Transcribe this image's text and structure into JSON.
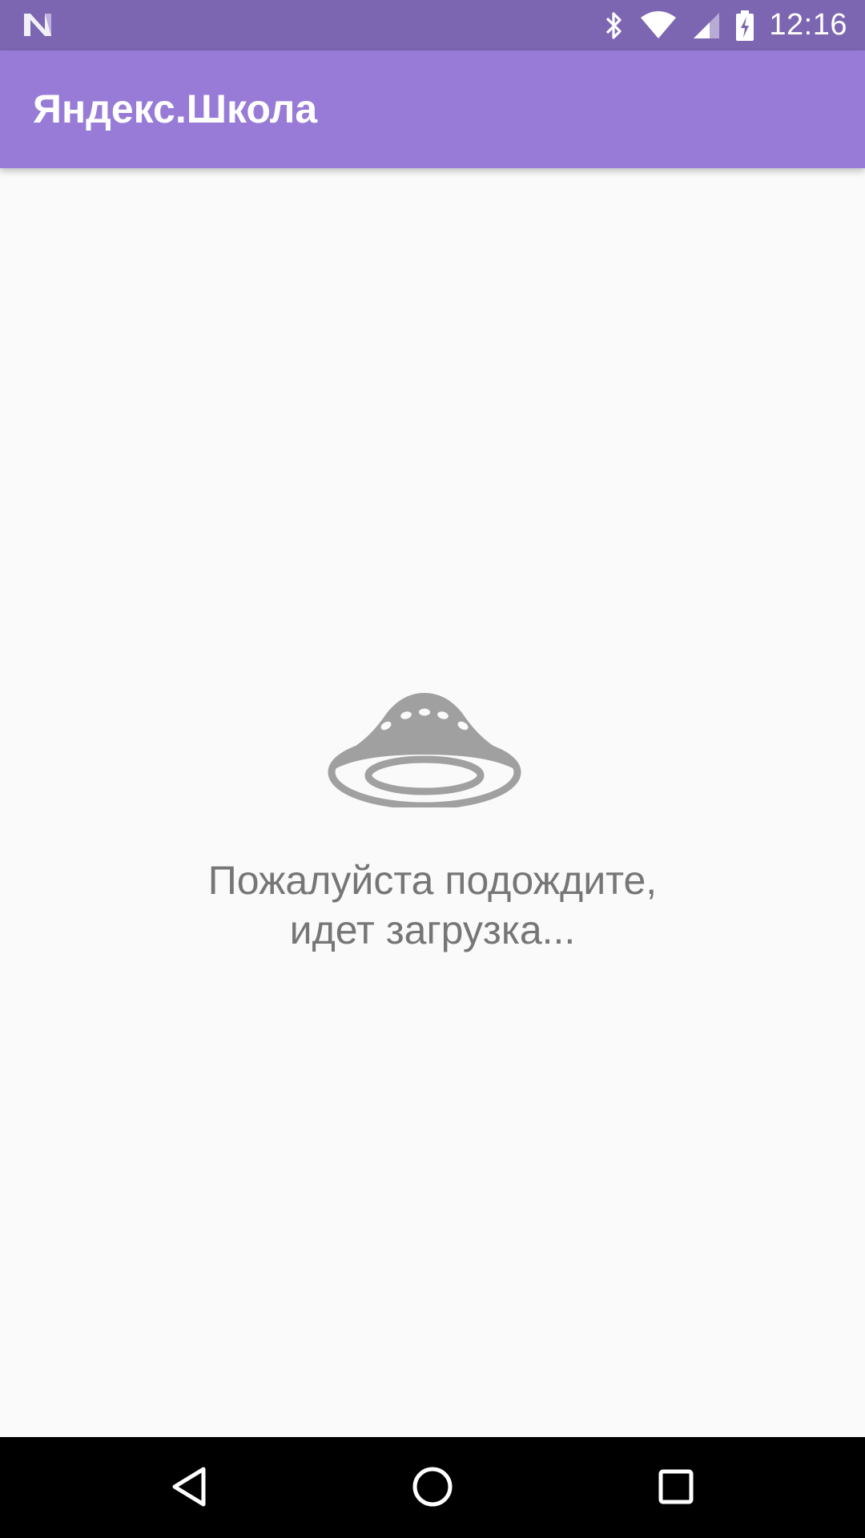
{
  "status_bar": {
    "time": "12:16",
    "icons": [
      "notification-n-icon",
      "bluetooth-icon",
      "wifi-icon",
      "cellular-signal-icon",
      "battery-charging-icon"
    ]
  },
  "app_bar": {
    "title": "Яндекс.Школа",
    "color": "#977bd6"
  },
  "loading": {
    "icon": "ufo-icon",
    "line1": "Пожалуйста подождите,",
    "line2": "идет загрузка..."
  },
  "nav_bar": {
    "buttons": [
      "back-icon",
      "home-icon",
      "recents-icon"
    ]
  }
}
